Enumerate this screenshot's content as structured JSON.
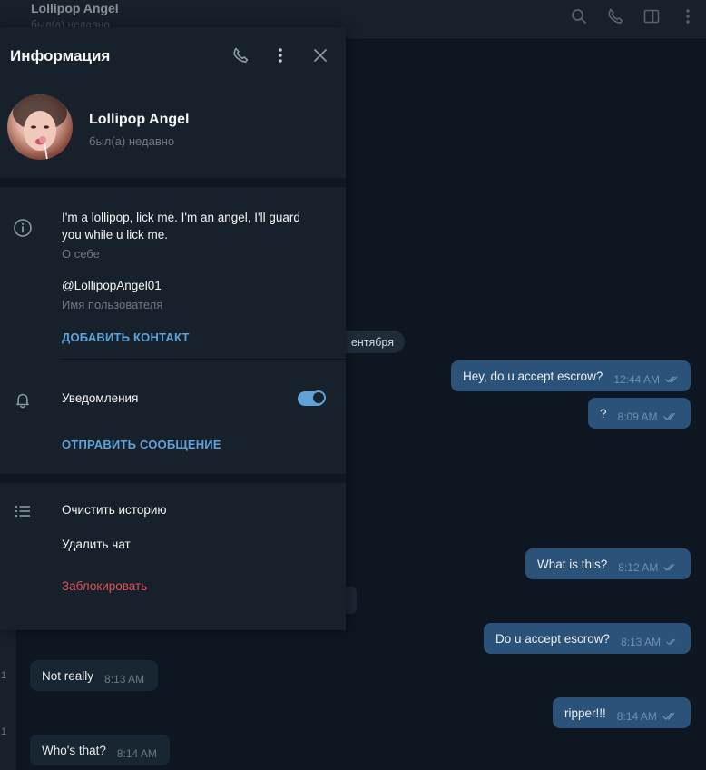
{
  "chat": {
    "title": "Lollipop Angel",
    "status": "был(а) недавно",
    "date_label": "ентября",
    "left_marks": [
      "1",
      "1"
    ],
    "messages": [
      {
        "text": "Hey, do u accept escrow?",
        "time": "12:44 AM",
        "direction": "out"
      },
      {
        "text": "?",
        "time": "8:09 AM",
        "direction": "out"
      },
      {
        "text": "What is this?",
        "time": "8:12 AM",
        "direction": "out"
      },
      {
        "text": "Do u accept escrow?",
        "time": "8:13 AM",
        "direction": "out"
      },
      {
        "text": "Not really",
        "time": "8:13 AM",
        "direction": "in"
      },
      {
        "text": "ripper!!!",
        "time": "8:14 AM",
        "direction": "out"
      },
      {
        "text": "Who's that?",
        "time": "8:14 AM",
        "direction": "in"
      }
    ],
    "header_icons": [
      "search-icon",
      "phone-icon",
      "sidebar-icon",
      "more-vertical-icon"
    ]
  },
  "info_panel": {
    "title": "Информация",
    "header_icons": [
      "phone-icon",
      "more-vertical-icon",
      "close-icon"
    ],
    "profile": {
      "name": "Lollipop Angel",
      "status": "был(а) недавно"
    },
    "about": {
      "text_line1": "I'm a lollipop, lick me. I'm an angel, I'll guard",
      "text_line2": "you while u lick me.",
      "label": "О себе"
    },
    "username": {
      "value": "@LollipopAngel01",
      "label": "Имя пользователя"
    },
    "add_contact": "ДОБАВИТЬ КОНТАКТ",
    "notifications": {
      "label": "Уведомления",
      "enabled": true
    },
    "send_message": "ОТПРАВИТЬ СООБЩЕНИЕ",
    "actions": {
      "clear_history": "Очистить историю",
      "delete_chat": "Удалить чат",
      "block": "Заблокировать"
    }
  },
  "colors": {
    "background": "#0e1621",
    "panel": "#17212b",
    "outgoing_bubble": "#2b5278",
    "incoming_bubble": "#182533",
    "accent": "#5ea2d8",
    "danger": "#e0515a",
    "muted": "#6d7883"
  }
}
